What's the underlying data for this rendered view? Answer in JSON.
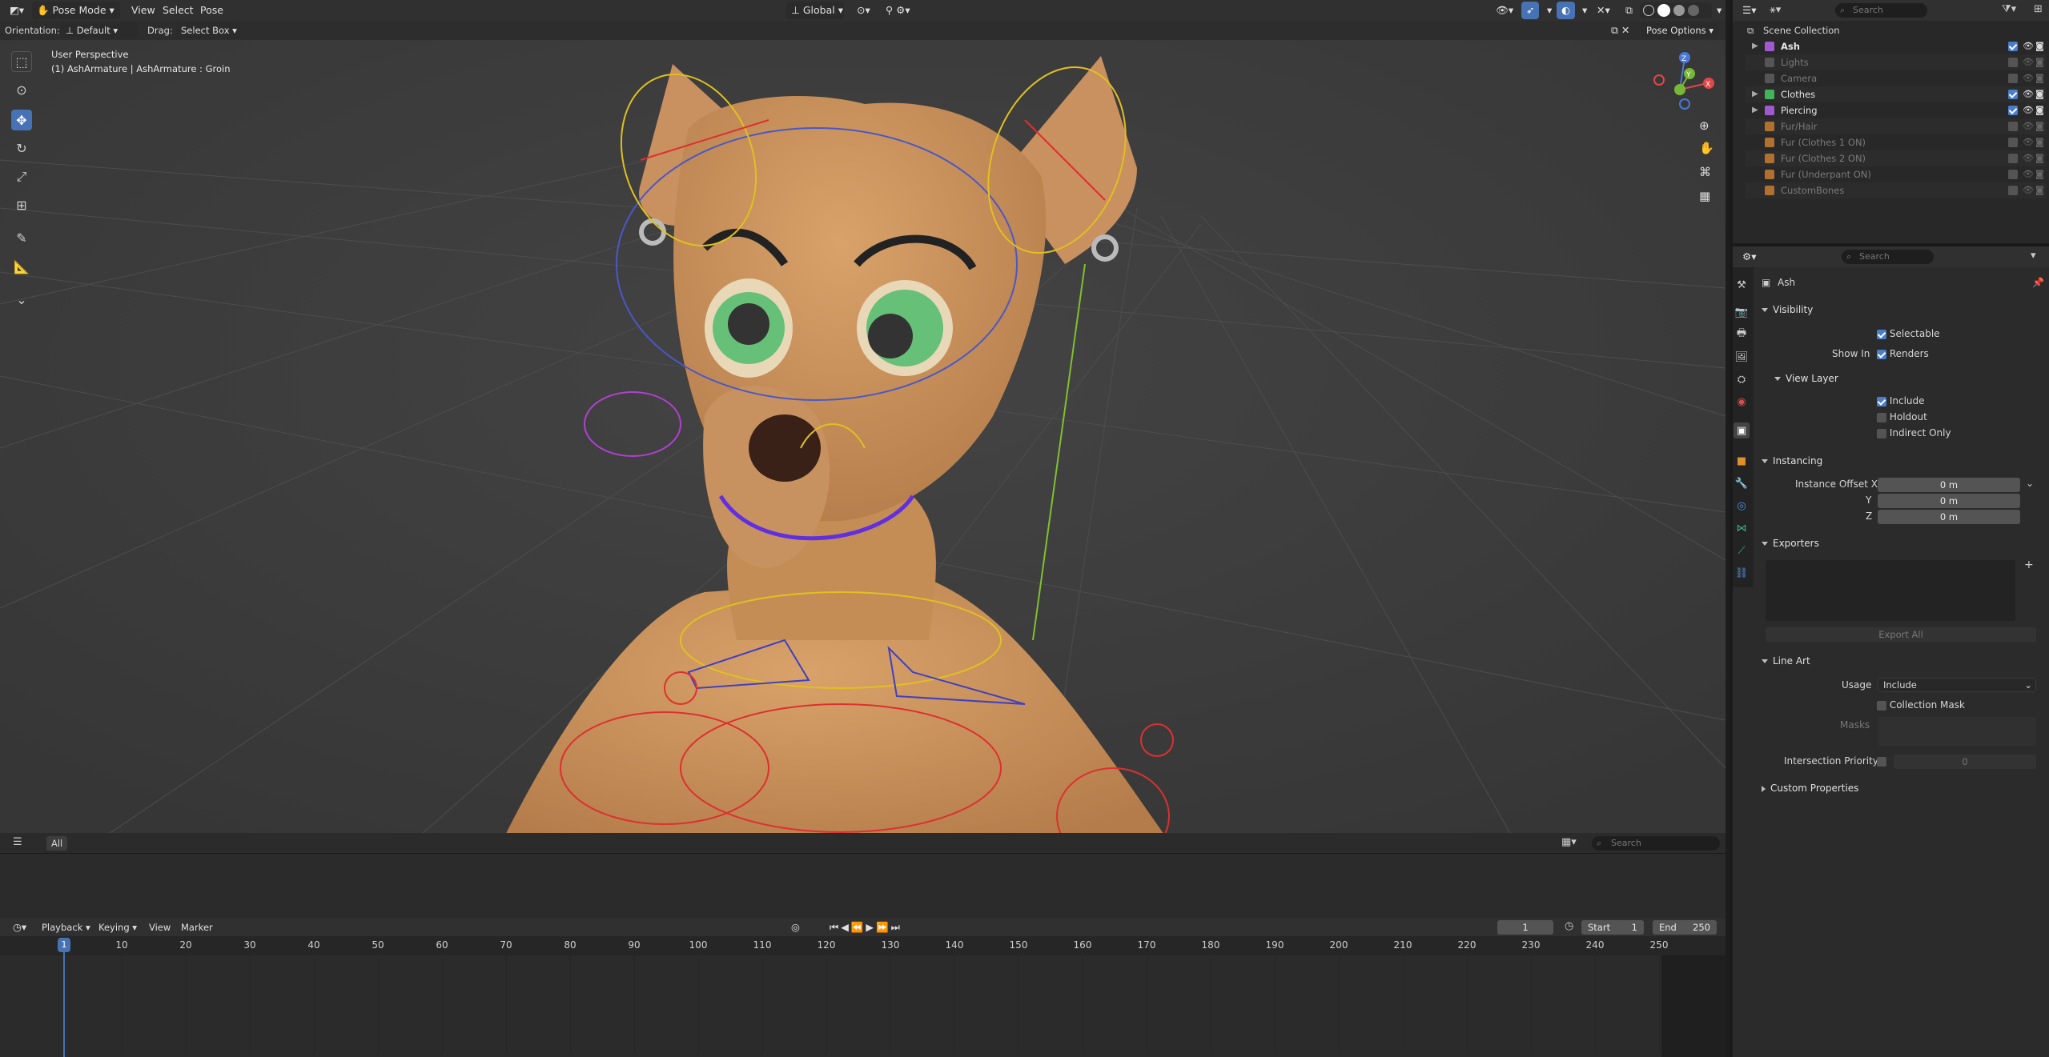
{
  "viewport": {
    "mode": "Pose Mode",
    "menus": [
      "View",
      "Select",
      "Pose"
    ],
    "orientation_label": "Orientation:",
    "orientation_value": "Default",
    "drag_label": "Drag:",
    "drag_value": "Select Box",
    "transform": "Global",
    "pose_options": "Pose Options",
    "overlay_line1": "User Perspective",
    "overlay_line2": "(1) AshArmature | AshArmature : Groin",
    "axis_x": "X",
    "axis_y": "Y",
    "axis_z": "Z"
  },
  "outliner": {
    "search_placeholder": "Search",
    "root": "Scene Collection",
    "items": [
      {
        "label": "Ash",
        "color": "#a05ad0",
        "bold": true,
        "checked": true,
        "enabled": true
      },
      {
        "label": "Lights",
        "color": "#555",
        "checked": false,
        "enabled": false
      },
      {
        "label": "Camera",
        "color": "#555",
        "checked": false,
        "enabled": false
      },
      {
        "label": "Clothes",
        "color": "#43b35a",
        "checked": true,
        "enabled": true
      },
      {
        "label": "Piercing",
        "color": "#a05ad0",
        "checked": true,
        "enabled": true
      },
      {
        "label": "Fur/Hair",
        "color": "#b07030",
        "checked": false,
        "enabled": false
      },
      {
        "label": "Fur (Clothes 1 ON)",
        "color": "#b07030",
        "checked": false,
        "enabled": false
      },
      {
        "label": "Fur (Clothes 2 ON)",
        "color": "#b07030",
        "checked": false,
        "enabled": false
      },
      {
        "label": "Fur (Underpant ON)",
        "color": "#b07030",
        "checked": false,
        "enabled": false
      },
      {
        "label": "CustomBones",
        "color": "#b07030",
        "checked": false,
        "enabled": false
      }
    ]
  },
  "properties": {
    "search_placeholder": "Search",
    "collection_name": "Ash",
    "visibility": {
      "title": "Visibility",
      "selectable": "Selectable",
      "show_in": "Show In",
      "renders": "Renders"
    },
    "view_layer": {
      "title": "View Layer",
      "include": "Include",
      "holdout": "Holdout",
      "indirect_only": "Indirect Only"
    },
    "instancing": {
      "title": "Instancing",
      "offset_x_label": "Instance Offset X",
      "y_label": "Y",
      "z_label": "Z",
      "x": "0 m",
      "y": "0 m",
      "z": "0 m"
    },
    "exporters": {
      "title": "Exporters",
      "export_all": "Export All"
    },
    "line_art": {
      "title": "Line Art",
      "usage_label": "Usage",
      "usage_value": "Include",
      "collection_mask": "Collection Mask",
      "masks": "Masks",
      "intersection_priority": "Intersection Priority",
      "priority_value": "0"
    },
    "custom_properties": "Custom Properties"
  },
  "status_strip": {
    "all": "All",
    "search_placeholder": "Search"
  },
  "timeline": {
    "menus": [
      "Playback",
      "Keying",
      "View",
      "Marker"
    ],
    "current_frame": "1",
    "start_label": "Start",
    "start": "1",
    "end_label": "End",
    "end": "250",
    "ticks": [
      "1",
      "10",
      "20",
      "30",
      "40",
      "50",
      "60",
      "70",
      "80",
      "90",
      "100",
      "110",
      "120",
      "130",
      "140",
      "150",
      "160",
      "170",
      "180",
      "190",
      "200",
      "210",
      "220",
      "230",
      "240",
      "250"
    ]
  }
}
